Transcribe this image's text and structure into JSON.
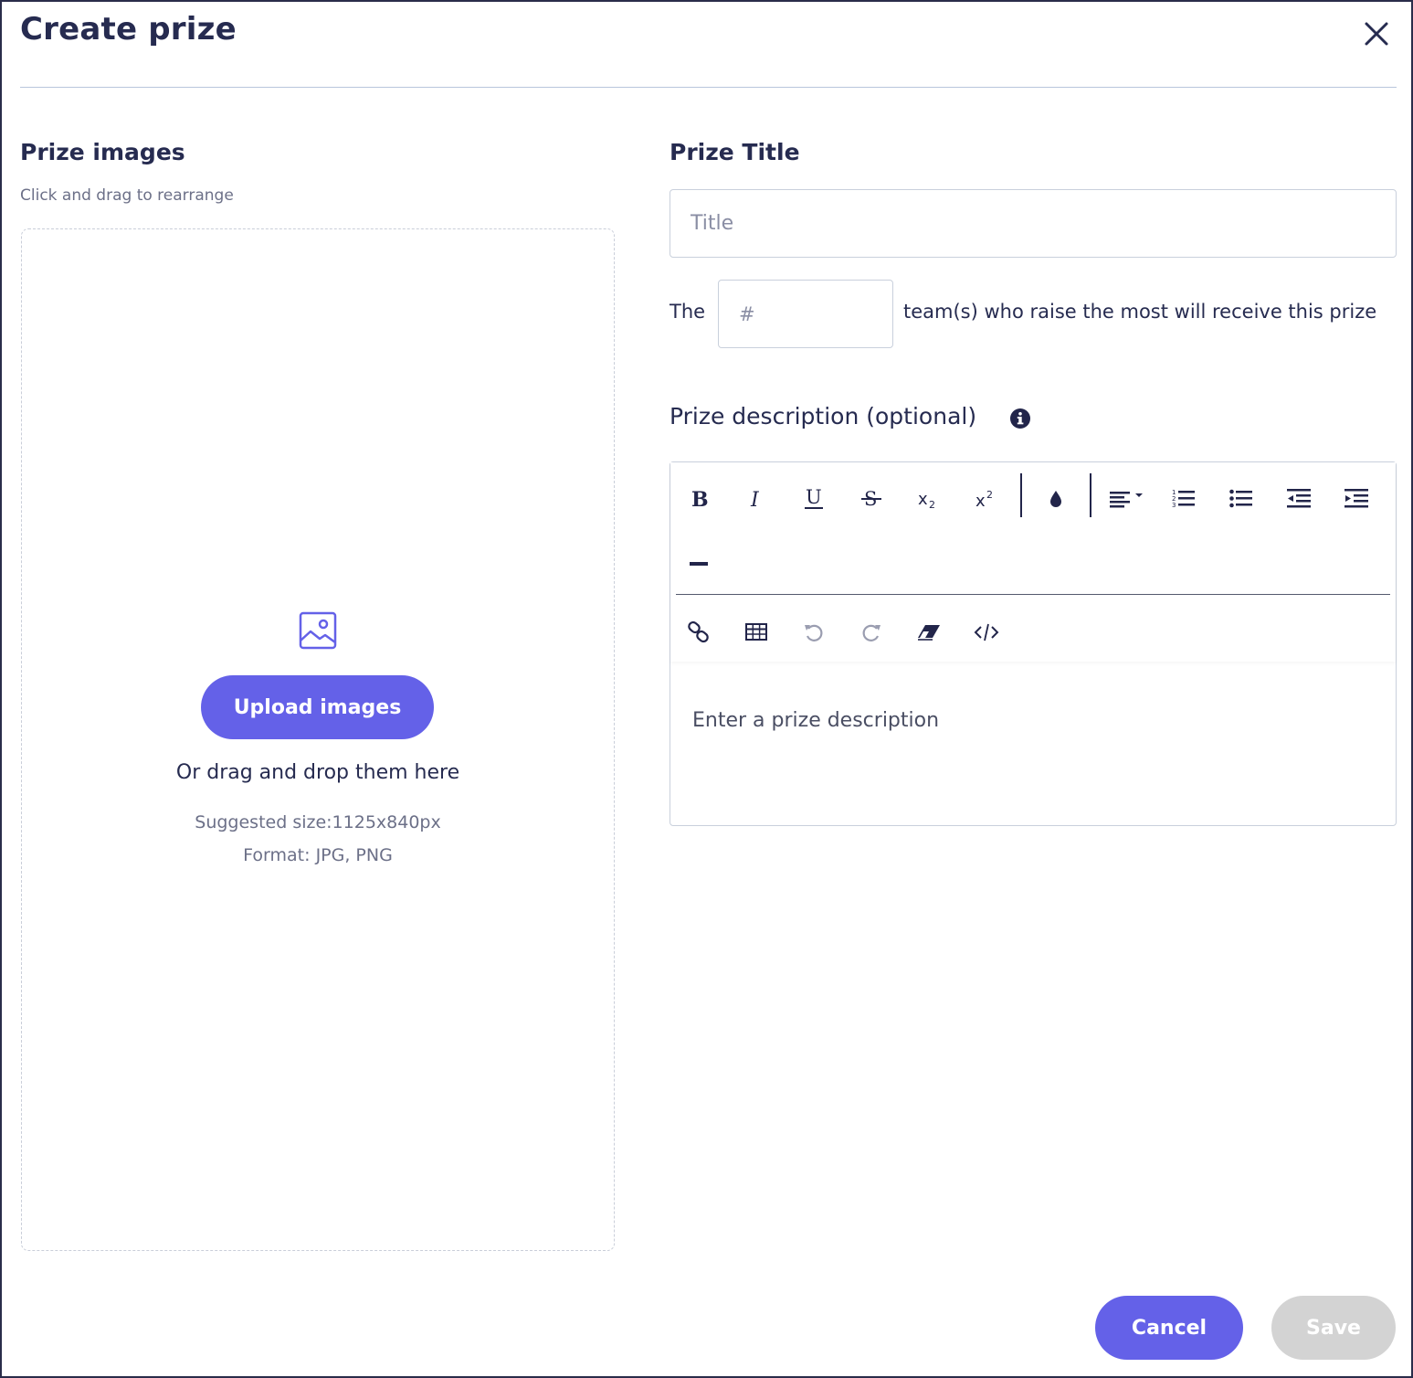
{
  "dialog": {
    "title": "Create prize",
    "close_icon": "close-icon"
  },
  "images": {
    "label": "Prize images",
    "hint": "Click and drag to rearrange",
    "icon": "image-icon",
    "upload_label": "Upload images",
    "drag_text": "Or drag and drop them here",
    "size_text": "Suggested size:1125x840px",
    "format_text": "Format: JPG, PNG"
  },
  "prize_title": {
    "label": "Prize Title",
    "value": "",
    "placeholder": "Title"
  },
  "teams": {
    "prefix": "The",
    "value": "",
    "placeholder": "#",
    "suffix": "team(s) who raise the most will receive this prize"
  },
  "description": {
    "label": "Prize description (optional)",
    "info_icon": "info-icon",
    "placeholder": "Enter a prize description",
    "toolbar": [
      "bold-icon",
      "italic-icon",
      "underline-icon",
      "strikethrough-icon",
      "subscript-icon",
      "superscript-icon",
      "text-color-icon",
      "align-icon",
      "ordered-list-icon",
      "unordered-list-icon",
      "outdent-icon",
      "indent-icon",
      "horizontal-rule-icon",
      "link-icon",
      "table-icon",
      "undo-icon",
      "redo-icon",
      "clear-format-icon",
      "code-view-icon"
    ]
  },
  "footer": {
    "cancel_label": "Cancel",
    "save_label": "Save"
  },
  "colors": {
    "accent": "#6461e8",
    "text": "#262b50",
    "muted": "#6c7088",
    "disabled": "#d3d3d3"
  }
}
